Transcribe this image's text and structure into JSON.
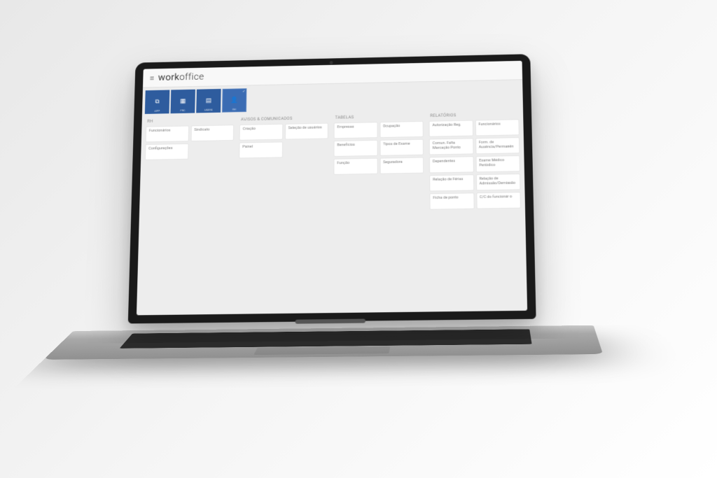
{
  "header": {
    "logo_part1": "work",
    "logo_part2": "office"
  },
  "nav": [
    {
      "label": "APP",
      "icon": "⧉",
      "active": false
    },
    {
      "label": "FRC",
      "icon": "▦",
      "active": false
    },
    {
      "label": "USERS",
      "icon": "▤",
      "active": false
    },
    {
      "label": "RH",
      "icon": "👤",
      "active": true
    }
  ],
  "columns": [
    {
      "header": "RH",
      "cards": [
        "Funcionários",
        "Sindicato",
        "Configurações",
        ""
      ]
    },
    {
      "header": "AVISOS & COMUNICADOS",
      "cards": [
        "Criação",
        "Seleção de usuários",
        "Painel",
        ""
      ]
    },
    {
      "header": "TABELAS",
      "cards": [
        "Empresas",
        "Ocupação",
        "Benefícios",
        "Tipos de Exame",
        "Função",
        "Seguradora"
      ]
    },
    {
      "header": "RELATÓRIOS",
      "cards": [
        "Autorização Reg.",
        "Funcionários",
        "Comun. Falta Marcação Ponto",
        "Form. de Ausência/Permanên",
        "Dependentes",
        "Exame Médico Periódico",
        "Relação de Férias",
        "Relação de Admissão/Demissão",
        "Ficha de ponto",
        "C/C do funcionário"
      ]
    }
  ]
}
